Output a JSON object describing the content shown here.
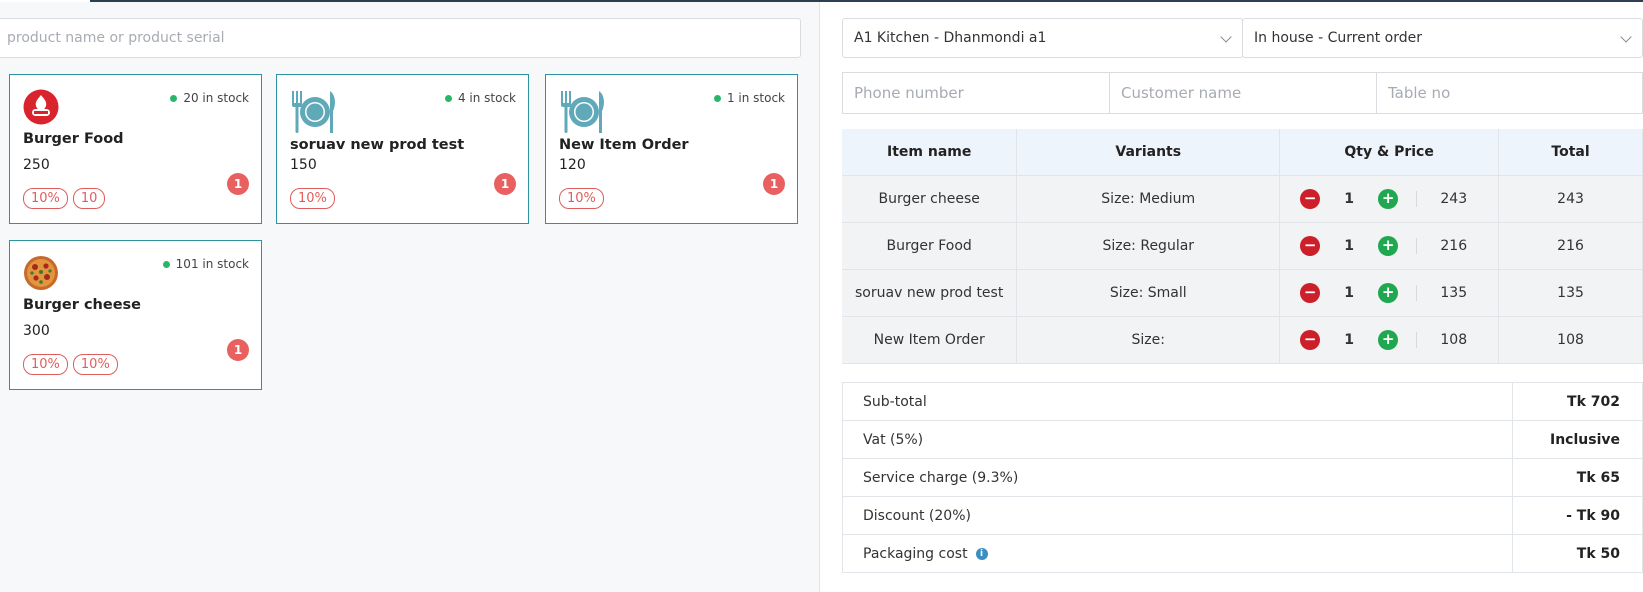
{
  "search": {
    "placeholder": "product name or product serial"
  },
  "products": [
    {
      "name": "Burger Food",
      "price": "250",
      "stock": "20 in stock",
      "tags": [
        "10%",
        "10"
      ],
      "count": "1",
      "logo": "brand-logo-icon"
    },
    {
      "name": "soruav new prod test",
      "price": "150",
      "stock": "4 in stock",
      "tags": [
        "10%"
      ],
      "count": "1",
      "logo": "plate-cutlery-icon"
    },
    {
      "name": "New Item Order",
      "price": "120",
      "stock": "1 in stock",
      "tags": [
        "10%"
      ],
      "count": "1",
      "logo": "plate-cutlery-icon"
    },
    {
      "name": "Burger cheese",
      "price": "300",
      "stock": "101 in stock",
      "tags": [
        "10%",
        "10%"
      ],
      "count": "1",
      "logo": "pizza-icon"
    }
  ],
  "order": {
    "kitchen_select": "A1 Kitchen - Dhanmondi a1",
    "order_type_select": "In house - Current order",
    "phone_placeholder": "Phone number",
    "customer_placeholder": "Customer name",
    "table_placeholder": "Table no"
  },
  "items_table": {
    "headers": [
      "Item name",
      "Variants",
      "Qty & Price",
      "Total"
    ],
    "rows": [
      {
        "name": "Burger cheese",
        "variant": "Size: Medium",
        "qty": "1",
        "price": "243",
        "total": "243"
      },
      {
        "name": "Burger Food",
        "variant": "Size: Regular",
        "qty": "1",
        "price": "216",
        "total": "216"
      },
      {
        "name": "soruav new prod test",
        "variant": "Size: Small",
        "qty": "1",
        "price": "135",
        "total": "135"
      },
      {
        "name": "New Item Order",
        "variant": "Size:",
        "qty": "1",
        "price": "108",
        "total": "108"
      }
    ]
  },
  "summary": [
    {
      "label": "Sub-total",
      "value": "Tk 702"
    },
    {
      "label": "Vat (5%)",
      "value": "Inclusive"
    },
    {
      "label": "Service charge (9.3%)",
      "value": "Tk 65"
    },
    {
      "label": "Discount (20%)",
      "value": "- Tk 90"
    },
    {
      "label": "Packaging cost",
      "value": "Tk 50"
    }
  ],
  "colors": {
    "accent": "#2d93a0",
    "danger": "#cc1f2a",
    "success": "#1fa84f",
    "badge": "#e86060"
  }
}
